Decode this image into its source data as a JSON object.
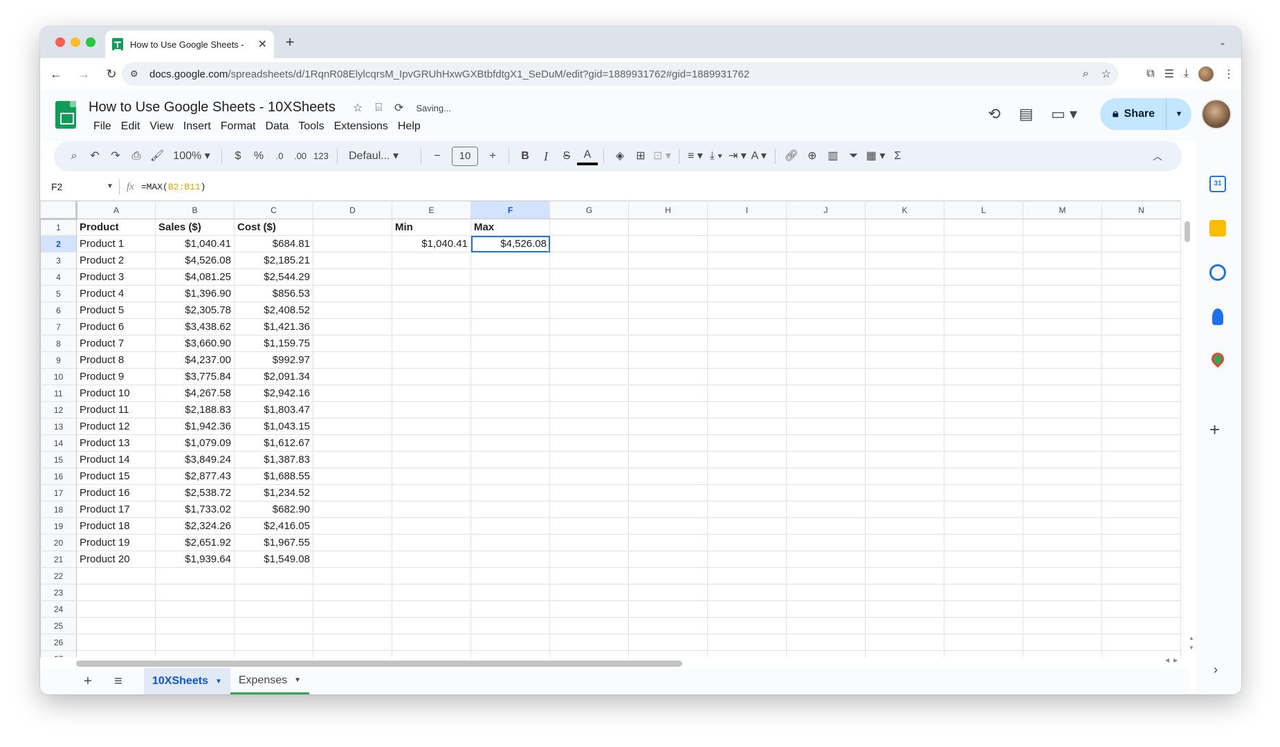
{
  "browser": {
    "tab_title": "How to Use Google Sheets - ",
    "url_host": "docs.google.com",
    "url_path": "/spreadsheets/d/1RqnR08ElylcqrsM_IpvGRUhHxwGXBtbfdtgX1_SeDuM/edit?gid=1889931762#gid=1889931762"
  },
  "doc": {
    "title": "How to Use Google Sheets - 10XSheets",
    "saving": "Saving...",
    "menus": [
      "File",
      "Edit",
      "View",
      "Insert",
      "Format",
      "Data",
      "Tools",
      "Extensions",
      "Help"
    ],
    "share_label": "Share"
  },
  "toolbar": {
    "zoom": "100%",
    "currency": "$",
    "percent": "%",
    "dec_decrease": ".0",
    "dec_increase": ".00",
    "number_format": "123",
    "font": "Defaul...",
    "font_size": "10"
  },
  "formula_bar": {
    "cell_ref": "F2",
    "formula_prefix": "=MAX(",
    "formula_range": "B2:B11",
    "formula_suffix": ")"
  },
  "columns": [
    "A",
    "B",
    "C",
    "D",
    "E",
    "F",
    "G",
    "H",
    "I",
    "J",
    "K",
    "L",
    "M",
    "N"
  ],
  "rows": [
    [
      "Product",
      "Sales ($)",
      "Cost ($)",
      "",
      "Min",
      "Max"
    ],
    [
      "Product 1",
      "$1,040.41",
      "$684.81",
      "",
      "$1,040.41",
      "$4,526.08"
    ],
    [
      "Product 2",
      "$4,526.08",
      "$2,185.21",
      "",
      "",
      ""
    ],
    [
      "Product 3",
      "$4,081.25",
      "$2,544.29",
      "",
      "",
      ""
    ],
    [
      "Product 4",
      "$1,396.90",
      "$856.53",
      "",
      "",
      ""
    ],
    [
      "Product 5",
      "$2,305.78",
      "$2,408.52",
      "",
      "",
      ""
    ],
    [
      "Product 6",
      "$3,438.62",
      "$1,421.36",
      "",
      "",
      ""
    ],
    [
      "Product 7",
      "$3,660.90",
      "$1,159.75",
      "",
      "",
      ""
    ],
    [
      "Product 8",
      "$4,237.00",
      "$992.97",
      "",
      "",
      ""
    ],
    [
      "Product 9",
      "$3,775.84",
      "$2,091.34",
      "",
      "",
      ""
    ],
    [
      "Product 10",
      "$4,267.58",
      "$2,942.16",
      "",
      "",
      ""
    ],
    [
      "Product 11",
      "$2,188.83",
      "$1,803.47",
      "",
      "",
      ""
    ],
    [
      "Product 12",
      "$1,942.36",
      "$1,043.15",
      "",
      "",
      ""
    ],
    [
      "Product 13",
      "$1,079.09",
      "$1,612.67",
      "",
      "",
      ""
    ],
    [
      "Product 14",
      "$3,849.24",
      "$1,387.83",
      "",
      "",
      ""
    ],
    [
      "Product 15",
      "$2,877.43",
      "$1,688.55",
      "",
      "",
      ""
    ],
    [
      "Product 16",
      "$2,538.72",
      "$1,234.52",
      "",
      "",
      ""
    ],
    [
      "Product 17",
      "$1,733.02",
      "$682.90",
      "",
      "",
      ""
    ],
    [
      "Product 18",
      "$2,324.26",
      "$2,416.05",
      "",
      "",
      ""
    ],
    [
      "Product 19",
      "$2,651.92",
      "$1,967.55",
      "",
      "",
      ""
    ],
    [
      "Product 20",
      "$1,939.64",
      "$1,549.08",
      "",
      "",
      ""
    ],
    [
      "",
      "",
      "",
      "",
      "",
      ""
    ],
    [
      "",
      "",
      "",
      "",
      "",
      ""
    ],
    [
      "",
      "",
      "",
      "",
      "",
      ""
    ],
    [
      "",
      "",
      "",
      "",
      "",
      ""
    ],
    [
      "",
      "",
      "",
      "",
      "",
      ""
    ],
    [
      "",
      "",
      "",
      "",
      "",
      ""
    ]
  ],
  "selected": {
    "row": 2,
    "col": "F"
  },
  "sheets": [
    {
      "name": "10XSheets",
      "active": true
    },
    {
      "name": "Expenses",
      "active": false
    }
  ],
  "side_panel": {
    "calendar_day": "31"
  },
  "colors": {
    "accent": "#1a73e8",
    "share_bg": "#c2e7ff",
    "toolbar_bg": "#edf2fa",
    "sheets_green": "#0f9d58"
  }
}
